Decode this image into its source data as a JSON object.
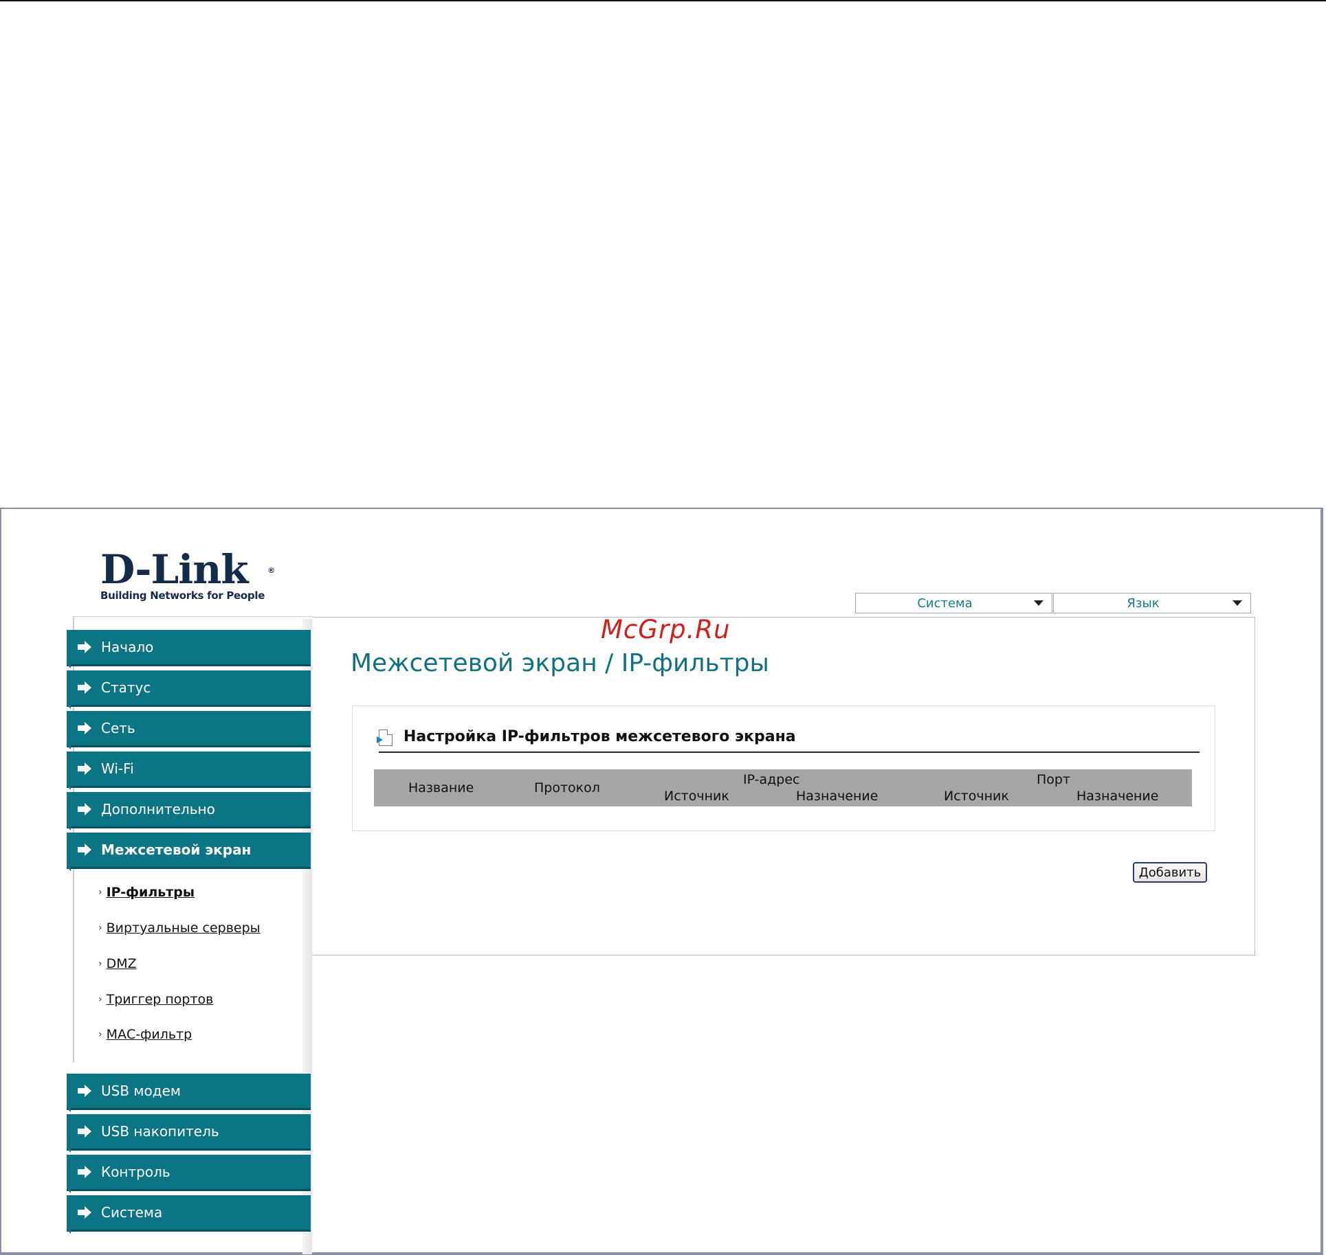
{
  "logo": {
    "brand": "D-Link",
    "registered": "®",
    "tagline": "Building Networks for People"
  },
  "watermark": "McGrp.Ru",
  "top_selects": {
    "system": "Система",
    "language": "Язык"
  },
  "nav": {
    "items_top": [
      "Начало",
      "Статус",
      "Сеть",
      "Wi-Fi",
      "Дополнительно"
    ],
    "active": "Межсетевой экран",
    "sub_items": [
      "IP-фильтры",
      "Виртуальные серверы",
      "DMZ",
      "Триггер портов",
      "МАС-фильтр"
    ],
    "items_bottom": [
      "USB модем",
      "USB накопитель",
      "Контроль",
      "Система"
    ]
  },
  "main": {
    "title": "Межсетевой экран / IP-фильтры",
    "panel_title": "Настройка IP-фильтров межсетевого экрана",
    "table_headers": {
      "name": "Название",
      "protocol": "Протокол",
      "ip_group": "IP-адрес",
      "ip_source": "Источник",
      "ip_dest": "Назначение",
      "port_group": "Порт",
      "port_source": "Источник",
      "port_dest": "Назначение"
    },
    "add_button": "Добавить"
  }
}
